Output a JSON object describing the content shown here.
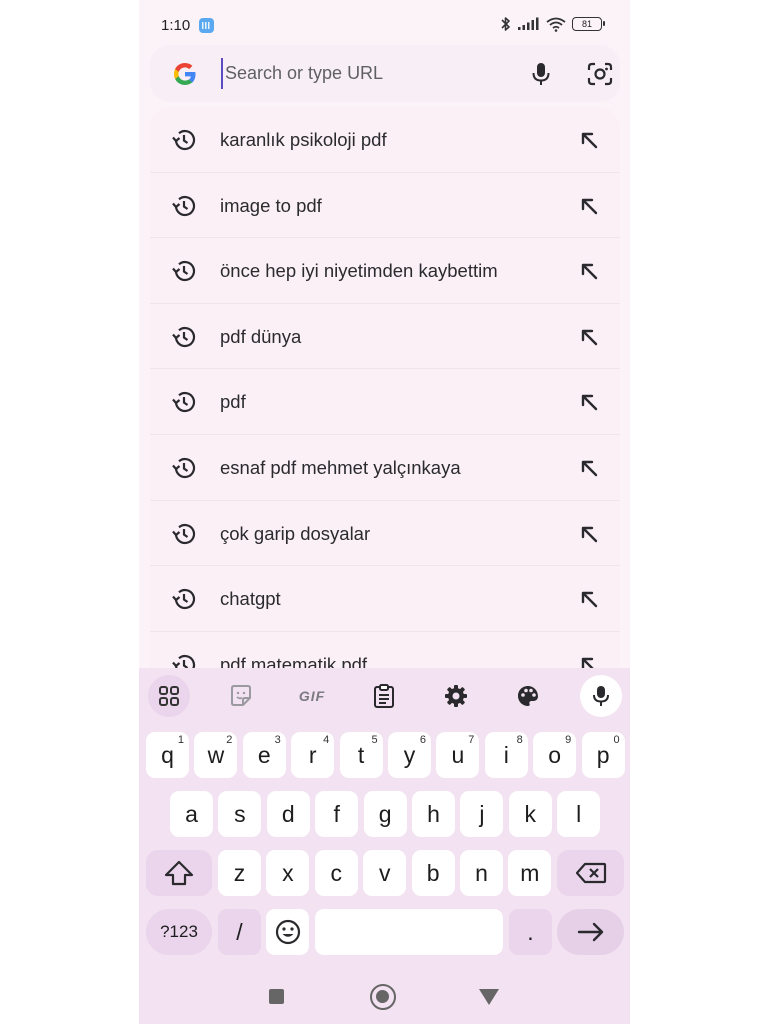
{
  "status": {
    "time": "1:10",
    "battery": "81"
  },
  "search": {
    "placeholder": "Search or type URL",
    "value": ""
  },
  "suggestions": [
    {
      "text": "karanlık psikoloji pdf"
    },
    {
      "text": "image to pdf"
    },
    {
      "text": "önce hep iyi niyetimden kaybettim"
    },
    {
      "text": "pdf dünya"
    },
    {
      "text": "pdf"
    },
    {
      "text": "esnaf pdf mehmet yalçınkaya"
    },
    {
      "text": "çok garip dosyalar"
    },
    {
      "text": "chatgpt"
    },
    {
      "text": "pdf matematik pdf"
    }
  ],
  "keyboard": {
    "toolbar": {
      "gif": "GIF"
    },
    "row1": [
      {
        "key": "q",
        "num": "1"
      },
      {
        "key": "w",
        "num": "2"
      },
      {
        "key": "e",
        "num": "3"
      },
      {
        "key": "r",
        "num": "4"
      },
      {
        "key": "t",
        "num": "5"
      },
      {
        "key": "y",
        "num": "6"
      },
      {
        "key": "u",
        "num": "7"
      },
      {
        "key": "i",
        "num": "8"
      },
      {
        "key": "o",
        "num": "9"
      },
      {
        "key": "p",
        "num": "0"
      }
    ],
    "row2": [
      "a",
      "s",
      "d",
      "f",
      "g",
      "h",
      "j",
      "k",
      "l"
    ],
    "row3": [
      "z",
      "x",
      "c",
      "v",
      "b",
      "n",
      "m"
    ],
    "symbols": "?123",
    "slash": "/",
    "period": "."
  },
  "colors": {
    "accent": "#5b4cc4",
    "keyboard_bg": "#f3e2f1",
    "page_bg": "#fbf3f8"
  }
}
